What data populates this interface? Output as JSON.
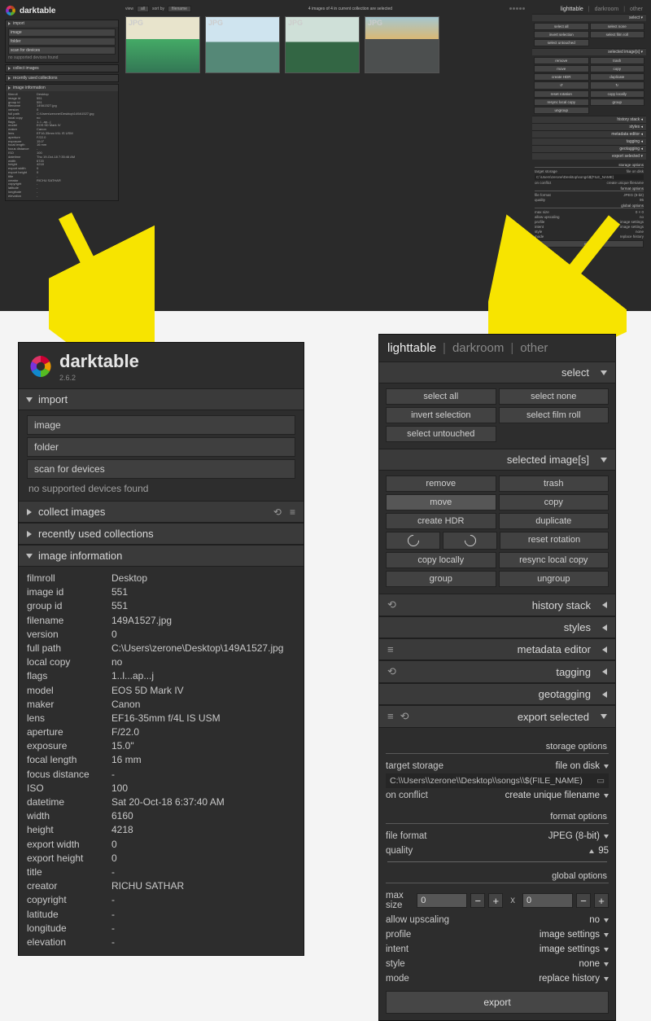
{
  "app": {
    "name": "darktable",
    "version": "2.6.2"
  },
  "top": {
    "status": "4 images of 4 in current collection are selected",
    "view_label": "view",
    "view_value": "all",
    "sort_label": "sort by",
    "sort_value": "filename",
    "views": {
      "lighttable": "lighttable",
      "darkroom": "darkroom",
      "other": "other"
    },
    "thumb_label": "JPG",
    "select_module": "select",
    "select_buttons": [
      "select all",
      "select none",
      "invert selection",
      "select film roll",
      "select untouched"
    ],
    "selimg_module": "selected image[s]",
    "selimg_buttons": [
      "remove",
      "trash",
      "move",
      "copy",
      "create HDR",
      "duplicate",
      "↺",
      "↻",
      "reset rotation",
      "copy locally",
      "resync local copy",
      "group",
      "ungroup"
    ],
    "modules_collapsed": [
      "history stack",
      "styles",
      "metadata editor",
      "tagging",
      "geotagging"
    ],
    "export_module": "export selected",
    "left_modules": {
      "import": "import",
      "import_buttons": [
        "image",
        "folder",
        "scan for devices"
      ],
      "import_note": "no supported devices found",
      "collect": "collect images",
      "recent": "recently used collections",
      "info": "image information"
    },
    "info_rows": [
      [
        "filmroll",
        "Desktop"
      ],
      [
        "image id",
        "551"
      ],
      [
        "group id",
        "551"
      ],
      [
        "filename",
        "149A1527.jpg"
      ],
      [
        "version",
        "0"
      ],
      [
        "full path",
        "C:\\Users\\zerone\\Desktop\\149A1527.jpg"
      ],
      [
        "local copy",
        "no"
      ],
      [
        "flags",
        "1..l...ap...j"
      ],
      [
        "model",
        "EOS 5D Mark IV"
      ],
      [
        "maker",
        "Canon"
      ],
      [
        "lens",
        "EF16-35mm f/4L IS USM"
      ],
      [
        "aperture",
        "F/22.0"
      ],
      [
        "exposure",
        "15.0\""
      ],
      [
        "focal length",
        "16 mm"
      ],
      [
        "focus distance",
        "-"
      ],
      [
        "ISO",
        "100"
      ],
      [
        "datetime",
        "Thu 19-Oct-18 7:35:46 AM"
      ],
      [
        "width",
        "6720"
      ],
      [
        "height",
        "4218"
      ],
      [
        "export width",
        "0"
      ],
      [
        "export height",
        "0"
      ],
      [
        "title",
        "-"
      ],
      [
        "creator",
        "RICHU SATHAR"
      ],
      [
        "copyright",
        "-"
      ],
      [
        "latitude",
        "-"
      ],
      [
        "longitude",
        "-"
      ],
      [
        "elevation",
        "-"
      ]
    ],
    "export": {
      "storage_options": "storage options",
      "target_storage": "target storage",
      "file_on_disk": "file on disk",
      "path": "C:\\Users\\zerone\\Desktop\\songs\\$(FILE_NAME)",
      "on_conflict": "on conflict",
      "conflict_val": "create unique filename",
      "format_options": "format options",
      "file_format": "file format",
      "format_val": "JPEG (8-bit)",
      "quality": "quality",
      "quality_val": "95",
      "global_options": "global options",
      "max_size": "max size",
      "w": "0",
      "h": "0",
      "allow_upscaling": "allow upscaling",
      "allow_val": "no",
      "profile": "profile",
      "profile_val": "image settings",
      "intent": "intent",
      "intent_val": "image settings",
      "style": "style",
      "style_val": "none",
      "mode": "mode",
      "mode_val": "replace history",
      "export_btn": "export"
    }
  },
  "left_panel": {
    "import": "import",
    "import_buttons": {
      "image": "image",
      "folder": "folder",
      "scan": "scan for devices"
    },
    "import_note": "no supported devices found",
    "collect": "collect images",
    "recent": "recently used collections",
    "info_header": "image information",
    "info_rows": [
      [
        "filmroll",
        "Desktop"
      ],
      [
        "image id",
        "551"
      ],
      [
        "group id",
        "551"
      ],
      [
        "filename",
        "149A1527.jpg"
      ],
      [
        "version",
        "0"
      ],
      [
        "full path",
        "C:\\Users\\zerone\\Desktop\\149A1527.jpg"
      ],
      [
        "local copy",
        "no"
      ],
      [
        "flags",
        "1..l...ap...j"
      ],
      [
        "model",
        "EOS 5D Mark IV"
      ],
      [
        "maker",
        "Canon"
      ],
      [
        "lens",
        "EF16-35mm f/4L IS USM"
      ],
      [
        "aperture",
        "F/22.0"
      ],
      [
        "exposure",
        "15.0\""
      ],
      [
        "focal length",
        "16 mm"
      ],
      [
        "focus distance",
        "-"
      ],
      [
        "ISO",
        "100"
      ],
      [
        "datetime",
        "Sat 20-Oct-18 6:37:40 AM"
      ],
      [
        "width",
        "6160"
      ],
      [
        "height",
        "4218"
      ],
      [
        "export width",
        "0"
      ],
      [
        "export height",
        "0"
      ],
      [
        "title",
        "-"
      ],
      [
        "creator",
        "RICHU SATHAR"
      ],
      [
        "copyright",
        "-"
      ],
      [
        "latitude",
        "-"
      ],
      [
        "longitude",
        "-"
      ],
      [
        "elevation",
        "-"
      ]
    ]
  },
  "right_panel": {
    "views": {
      "lighttable": "lighttable",
      "darkroom": "darkroom",
      "other": "other"
    },
    "select_module": "select",
    "select_buttons": {
      "all": "select all",
      "none": "select none",
      "invert": "invert selection",
      "roll": "select film roll",
      "untouched": "select untouched"
    },
    "selimg_module": "selected image[s]",
    "selimg_buttons": {
      "remove": "remove",
      "trash": "trash",
      "move": "move",
      "copy": "copy",
      "hdr": "create HDR",
      "dup": "duplicate",
      "rotl": "↺",
      "rotr": "↻",
      "reset": "reset rotation",
      "loc": "copy locally",
      "resync": "resync local copy",
      "grp": "group",
      "ungrp": "ungroup"
    },
    "collapsed": {
      "history": "history stack",
      "styles": "styles",
      "meta": "metadata editor",
      "tag": "tagging",
      "geo": "geotagging"
    },
    "export_module": "export selected",
    "export": {
      "storage_options": "storage options",
      "target_storage": "target storage",
      "file_on_disk": "file on disk",
      "path": "C:\\\\Users\\\\zerone\\\\Desktop\\\\songs\\\\$(FILE_NAME)",
      "on_conflict": "on conflict",
      "conflict_val": "create unique filename",
      "format_options": "format options",
      "file_format": "file format",
      "format_val": "JPEG (8-bit)",
      "quality": "quality",
      "quality_val": "95",
      "global_options": "global options",
      "max_size": "max size",
      "w": "0",
      "h": "0",
      "allow_upscaling": "allow upscaling",
      "allow_val": "no",
      "profile": "profile",
      "profile_val": "image settings",
      "intent": "intent",
      "intent_val": "image settings",
      "style": "style",
      "style_val": "none",
      "mode": "mode",
      "mode_val": "replace history",
      "export_btn": "export"
    }
  }
}
